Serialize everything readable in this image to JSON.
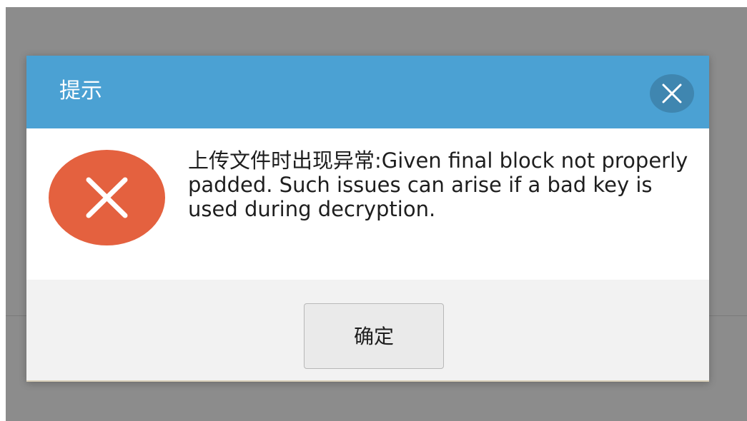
{
  "dialog": {
    "title": "提示",
    "close_icon": "close-icon",
    "error_icon": "error-x-icon",
    "message": "上传文件时出现异常:Given final block not properly padded. Such issues can arise if a bad key is used during decryption.",
    "ok_label": "确定"
  },
  "colors": {
    "header": "#4ba1d3",
    "close_button": "#3f86b0",
    "error_icon": "#e4613f",
    "backdrop": "#8c8c8c",
    "footer": "#f2f2f2"
  }
}
